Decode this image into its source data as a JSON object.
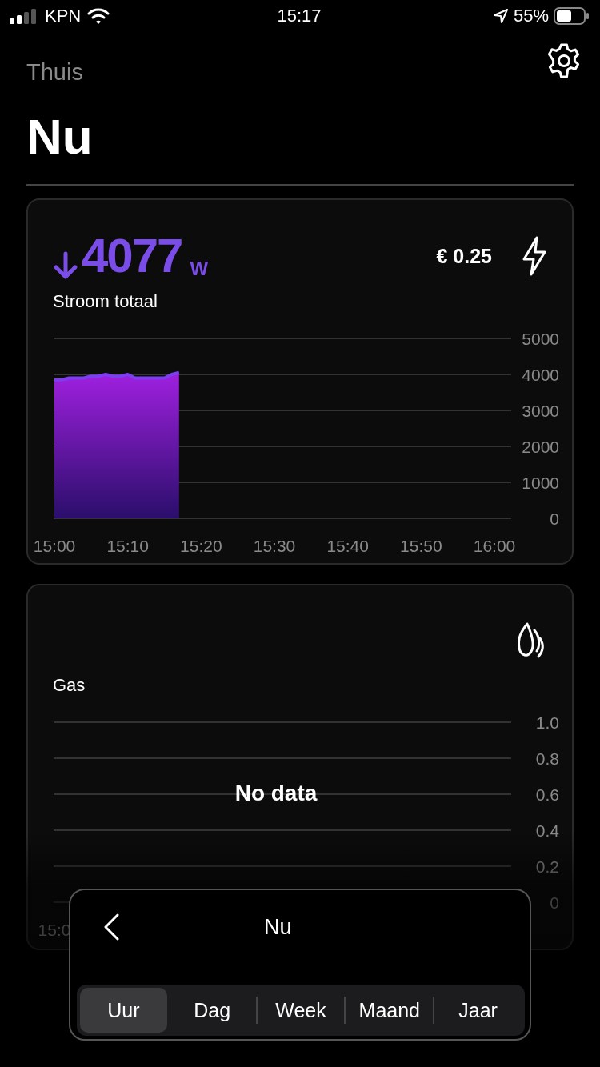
{
  "status_bar": {
    "carrier": "KPN",
    "time": "15:17",
    "battery": "55%"
  },
  "header": {
    "back_label": "Thuis",
    "title": "Nu"
  },
  "cards": [
    {
      "kind": "power",
      "value": "4077",
      "unit": "W",
      "label": "Stroom totaal",
      "cost": "€ 0.25",
      "chart_data": {
        "type": "area",
        "categories": [
          "15:00",
          null,
          null,
          null,
          null,
          null,
          null,
          null,
          null,
          null,
          "15:10",
          null,
          null,
          null,
          null,
          null,
          null,
          null,
          null,
          null,
          "15:20",
          null,
          null,
          null,
          null,
          null,
          null,
          null,
          null,
          null,
          "15:30",
          null,
          null,
          null,
          null,
          null,
          null,
          null,
          null,
          null,
          "15:40",
          null,
          null,
          null,
          null,
          null,
          null,
          null,
          null,
          null,
          "15:50",
          null,
          null,
          null,
          null,
          null,
          null,
          null,
          null,
          null,
          "16:00"
        ],
        "series": [
          {
            "color": "#7b3ff0",
            "values": [
              3850,
              3850,
              3900,
              3900,
              3900,
              3950,
              3950,
              4000,
              3950,
              3950,
              4000,
              3900,
              3900,
              3900,
              3900,
              3900,
              4000,
              4050,
              null,
              null,
              null,
              null,
              null,
              null,
              null,
              null,
              null,
              null,
              null,
              null,
              null,
              null,
              null,
              null,
              null,
              null,
              null,
              null,
              null,
              null,
              null,
              null,
              null,
              null,
              null,
              null,
              null,
              null,
              null,
              null,
              null,
              null,
              null,
              null,
              null,
              null,
              null,
              null,
              null,
              null,
              null
            ]
          }
        ],
        "ylim": [
          0,
          5000
        ],
        "grid": true,
        "yticks": [
          0,
          1000,
          2000,
          3000,
          4000,
          5000
        ]
      }
    },
    {
      "kind": "gas",
      "label": "Gas",
      "empty_text": "No data",
      "chart_data": {
        "type": "line",
        "categories": [
          "15:0",
          null,
          null,
          null,
          null,
          null,
          null,
          null,
          null,
          null,
          null,
          null,
          null,
          null,
          null,
          null,
          null,
          null,
          null,
          null,
          null,
          null,
          null,
          null,
          null,
          null,
          null,
          null,
          null,
          null,
          null,
          null,
          null,
          null,
          null,
          null,
          null,
          null,
          null,
          null,
          null,
          null,
          null,
          null,
          null,
          null,
          null,
          null,
          null,
          null,
          null,
          null,
          null,
          null,
          null,
          null,
          null,
          null,
          null,
          null,
          null
        ],
        "ylim": [
          0,
          1
        ],
        "grid": true,
        "yticks": [
          {
            "value": 0,
            "label": "0"
          },
          {
            "value": 0.2,
            "label": "0.2"
          },
          {
            "value": 0.4,
            "label": "0.4"
          },
          {
            "value": 0.6,
            "label": "0.6"
          },
          {
            "value": 0.8,
            "label": "0.8"
          },
          {
            "value": 1,
            "label": "1.0"
          }
        ]
      }
    }
  ],
  "period_panel": {
    "title": "Nu",
    "tabs": [
      {
        "label": "Uur",
        "selected": true
      },
      {
        "label": "Dag",
        "selected": false
      },
      {
        "label": "Week",
        "selected": false
      },
      {
        "label": "Maand",
        "selected": false
      },
      {
        "label": "Jaar",
        "selected": false
      }
    ]
  }
}
